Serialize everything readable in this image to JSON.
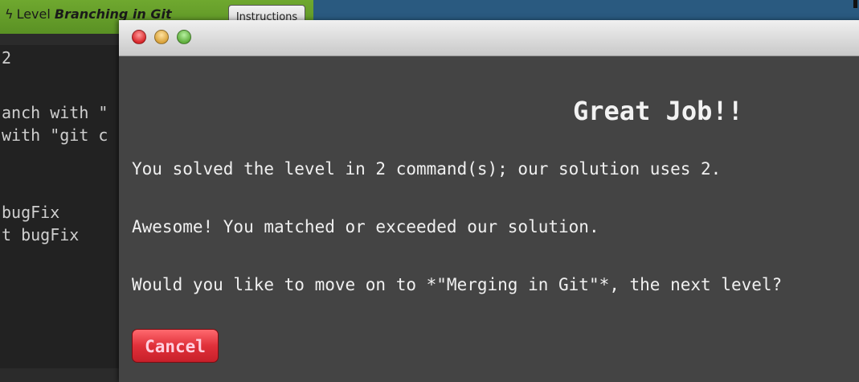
{
  "level_bar": {
    "bolt": "ϟ",
    "prefix": "Level",
    "level_name": "Branching in Git",
    "instructions_label": "Instructions"
  },
  "terminal": {
    "lines": [
      "2",
      "anch with \"",
      "with \"git c",
      "bugFix",
      "t bugFix"
    ]
  },
  "modal": {
    "title": "Great Job!!",
    "message_1": "You solved the level in 2 command(s); our solution uses 2.",
    "message_2": "Awesome! You matched or exceeded our solution.",
    "message_3": "Would you like to move on to *\"Merging in Git\"*, the next level?",
    "cancel_label": "Cancel"
  },
  "colors": {
    "level_bar": "#5a9124",
    "modal_bg": "#444444",
    "cancel_bg": "#d8283a",
    "blue_pane": "#2a5a80"
  }
}
